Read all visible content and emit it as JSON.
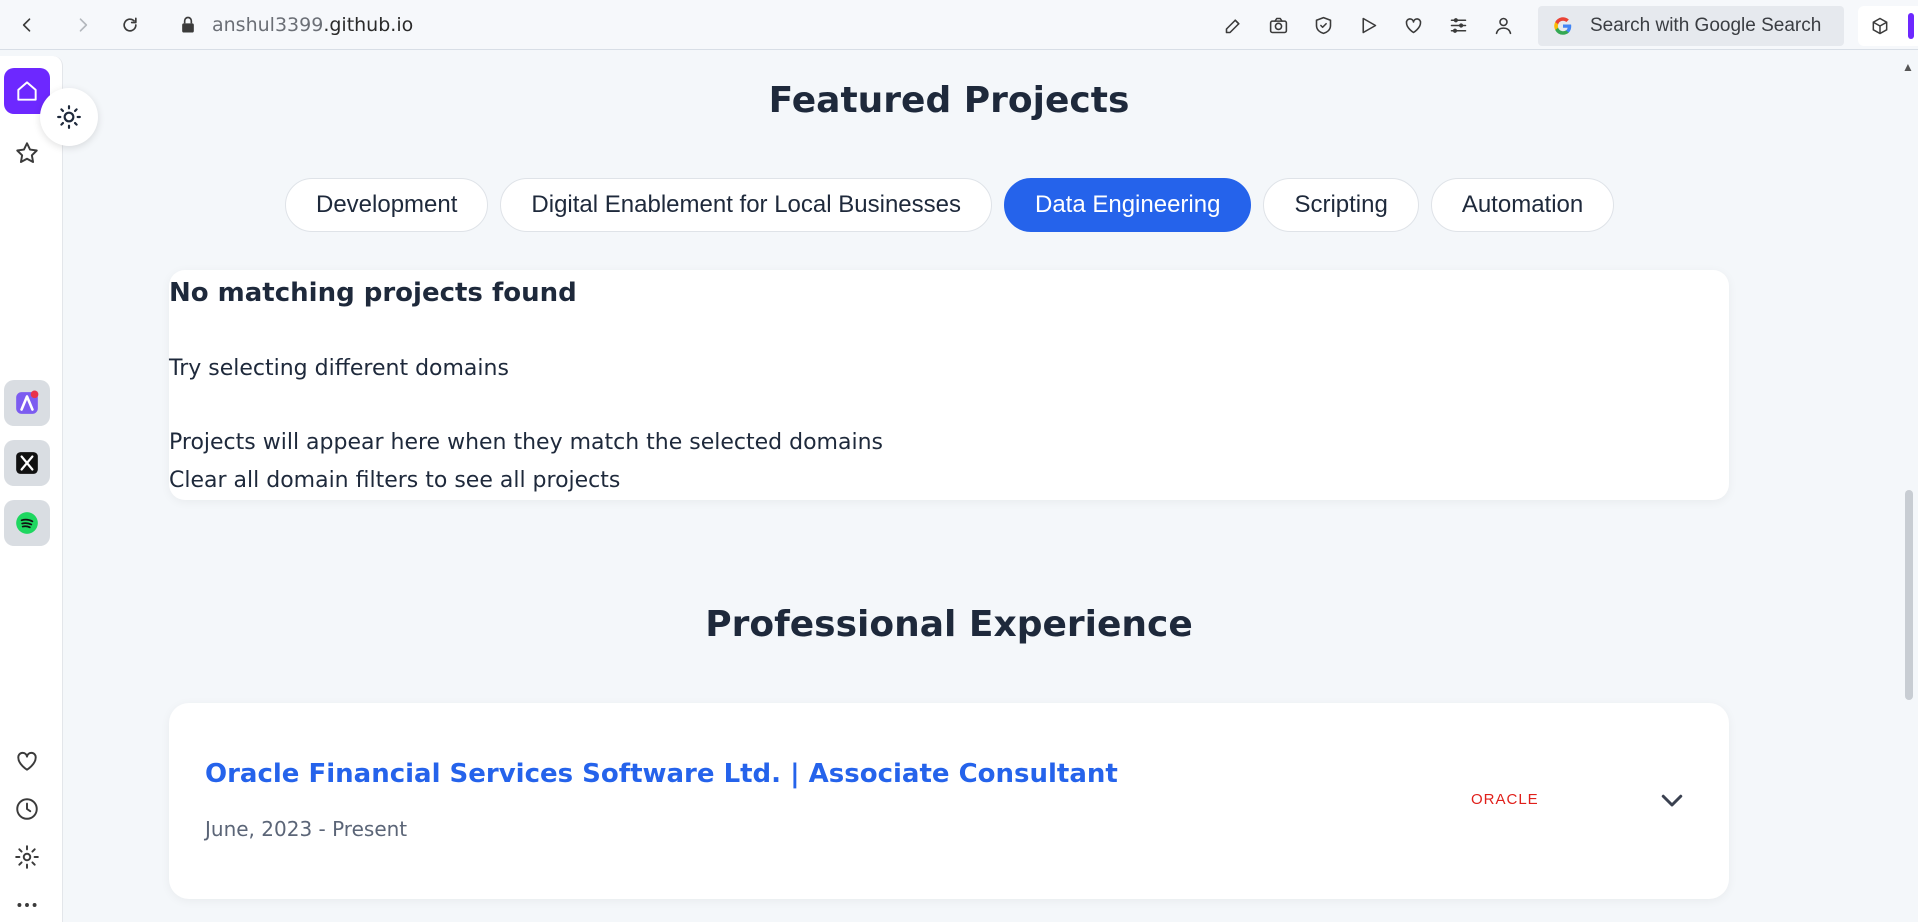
{
  "browser": {
    "url_prefix": "anshul3399",
    "url_domain": ".github.io",
    "search_placeholder": "Search with Google Search"
  },
  "projects": {
    "title": "Featured Projects",
    "filters": [
      "Development",
      "Digital Enablement for Local Businesses",
      "Data Engineering",
      "Scripting",
      "Automation"
    ],
    "active_filter": "Data Engineering",
    "empty_title": "No matching projects found",
    "empty_hint": "Try selecting different domains",
    "empty_note1": "Projects will appear here when they match the selected domains",
    "empty_note2": "Clear all domain filters to see all projects"
  },
  "experience": {
    "title": "Professional Experience",
    "items": [
      {
        "role": "Oracle Financial Services Software Ltd. | Associate Consultant",
        "period": "June, 2023 - Present",
        "logo_text": "ORACLE"
      }
    ]
  },
  "colors": {
    "accent": "#2563eb",
    "sidebar_accent": "#6d28ff",
    "oracle_red": "#e0201b"
  }
}
